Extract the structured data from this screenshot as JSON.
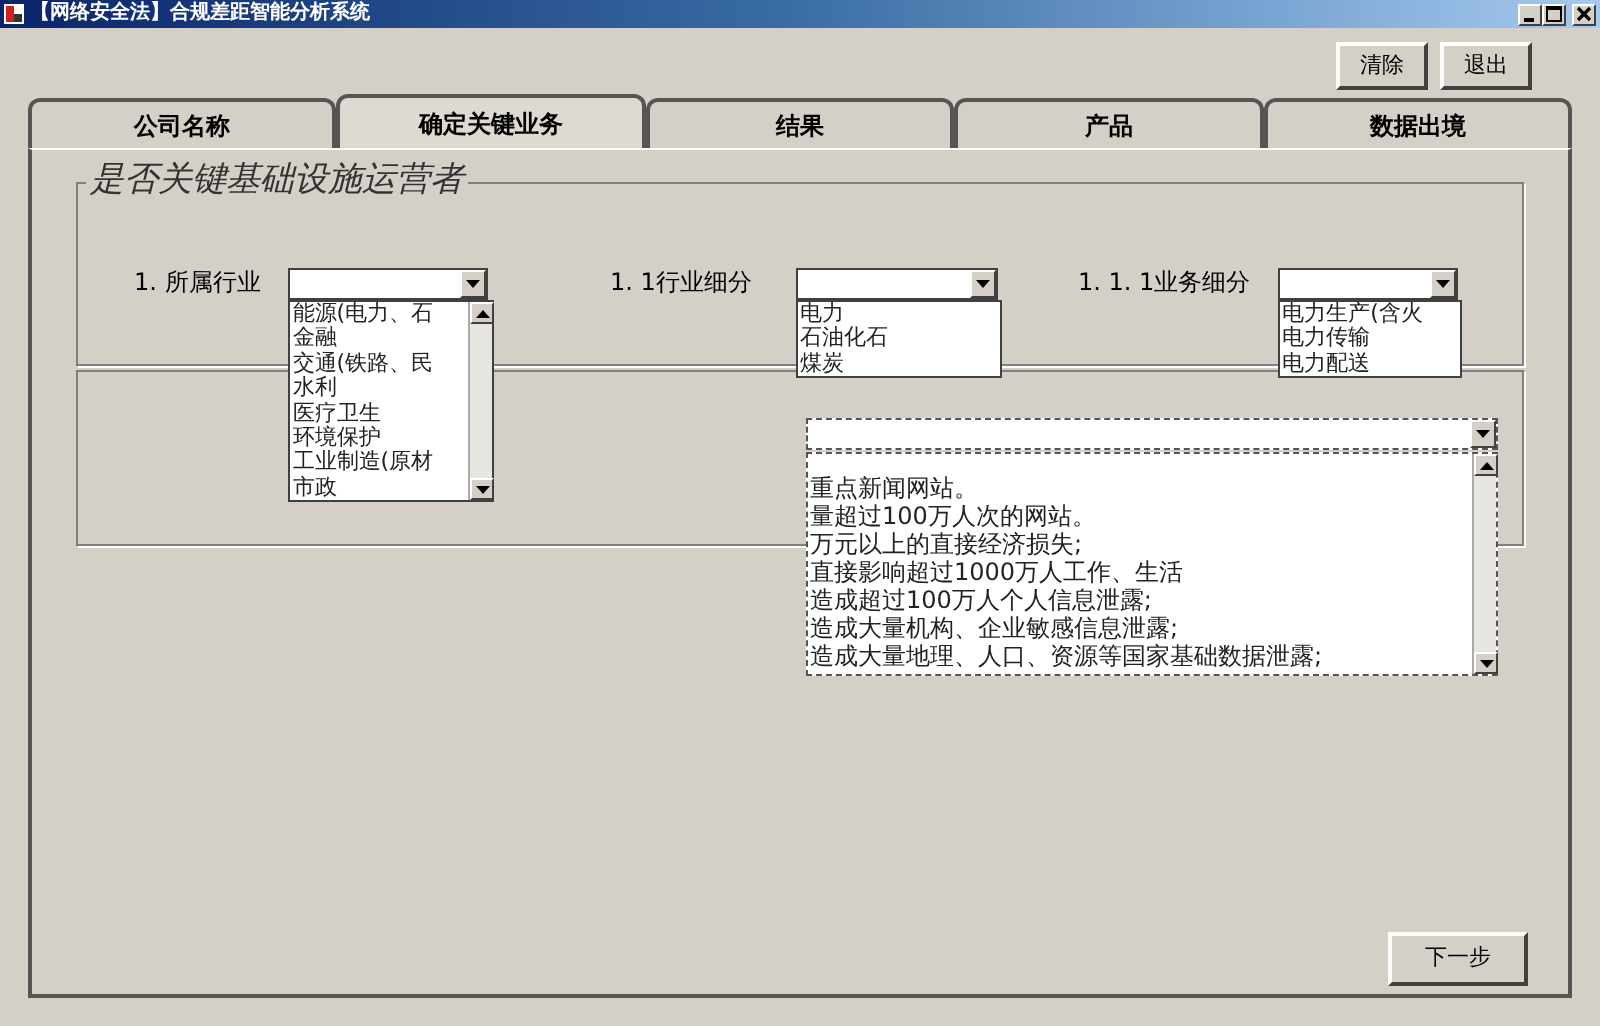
{
  "window": {
    "title": "【网络安全法】合规差距智能分析系统"
  },
  "toolbar_buttons": [
    "清除",
    "退出"
  ],
  "tabs": [
    {
      "label": "公司名称",
      "selected": false
    },
    {
      "label": "确定关键业务",
      "selected": true
    },
    {
      "label": "结果",
      "selected": false
    },
    {
      "label": "产品",
      "selected": false
    },
    {
      "label": "数据出境",
      "selected": false
    }
  ],
  "group": {
    "title": "是否关键基础设施运营者",
    "fields": [
      {
        "label": "1. 所属行业",
        "options": [
          "能源(电力、石",
          "金融",
          "交通(铁路、民",
          "水利",
          "医疗卫生",
          "环境保护",
          "工业制造(原材",
          "市政"
        ],
        "scrollbar": true
      },
      {
        "label": "1. 1行业细分",
        "options": [
          "电力",
          "石油化石",
          "煤炭"
        ],
        "scrollbar": false
      },
      {
        "label": "1. 1. 1业务细分",
        "options": [
          "电力生产(含火",
          "电力传输",
          "电力配送"
        ],
        "scrollbar": false
      }
    ]
  },
  "impact_list": {
    "options": [
      "重点新闻网站。",
      "量超过100万人次的网站。",
      "万元以上的直接经济损失;",
      "直接影响超过1000万人工作、生活",
      "造成超过100万人个人信息泄露;",
      "造成大量机构、企业敏感信息泄露;",
      "造成大量地理、人口、资源等国家基础数据泄露;"
    ]
  },
  "next_button": "下一步"
}
